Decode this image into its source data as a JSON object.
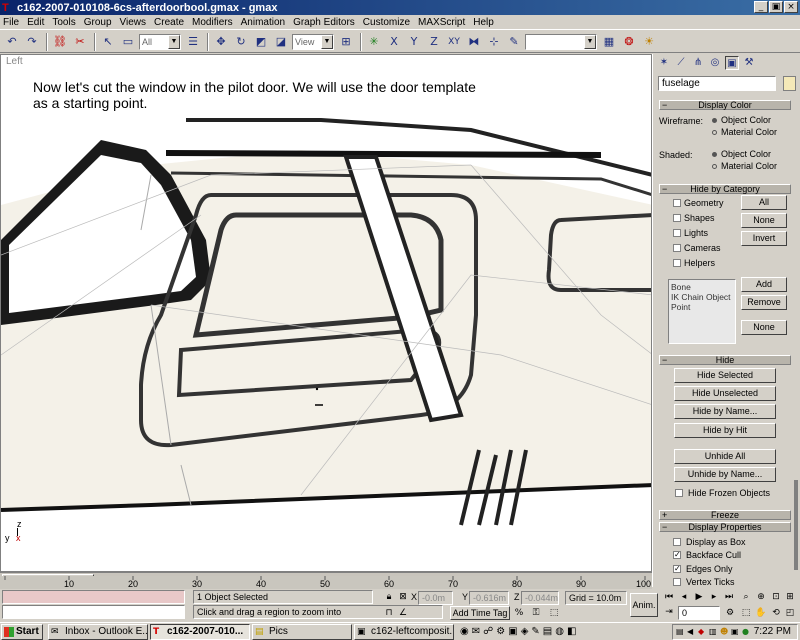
{
  "window": {
    "title": "c162-2007-010108-6cs-afterdoorbool.gmax - gmax",
    "minimize": "_",
    "restore": "▣",
    "close": "×"
  },
  "menu": [
    "File",
    "Edit",
    "Tools",
    "Group",
    "Views",
    "Create",
    "Modifiers",
    "Animation",
    "Graph Editors",
    "Customize",
    "MAXScript",
    "Help"
  ],
  "toolbar": {
    "selection_filter": "All",
    "reference_coord": "View",
    "snap_labels": [
      "X",
      "Y",
      "Z",
      "XY"
    ],
    "named_selection": ""
  },
  "viewport": {
    "label": "Left",
    "instruction": "Now let's cut the window in the pilot door.  We will use the door template as a starting point.",
    "axis_z": "z",
    "axis_y": "y",
    "axis_x": "x"
  },
  "command_panel": {
    "object_name": "fuselage",
    "display_color": {
      "title": "Display Color",
      "wireframe_label": "Wireframe:",
      "shaded_label": "Shaded:",
      "object_color": "Object Color",
      "material_color": "Material Color"
    },
    "hide_by_category": {
      "title": "Hide by Category",
      "items": [
        "Geometry",
        "Shapes",
        "Lights",
        "Cameras",
        "Helpers"
      ],
      "all_button": "All",
      "none_button": "None",
      "invert_button": "Invert",
      "list_items": [
        "Bone",
        "IK Chain Object",
        "Point"
      ],
      "add_button": "Add",
      "remove_button": "Remove",
      "none2_button": "None"
    },
    "hide": {
      "title": "Hide",
      "buttons": [
        "Hide Selected",
        "Hide Unselected",
        "Hide by Name...",
        "Hide by Hit",
        "Unhide All",
        "Unhide by Name..."
      ],
      "frozen_label": "Hide Frozen Objects"
    },
    "freeze": {
      "title": "Freeze"
    },
    "display_properties": {
      "title": "Display Properties",
      "items": [
        {
          "label": "Display as Box",
          "checked": false
        },
        {
          "label": "Backface Cull",
          "checked": true
        },
        {
          "label": "Edges Only",
          "checked": true
        },
        {
          "label": "Vertex Ticks",
          "checked": false
        }
      ]
    }
  },
  "timeline": {
    "slider_label": "0 / 100",
    "ticks": [
      "10",
      "20",
      "30",
      "40",
      "50",
      "60",
      "70",
      "80",
      "90",
      "100"
    ]
  },
  "status": {
    "selection": "1 Object Selected",
    "prompt": "Click and drag a region to zoom into",
    "x_label": "X",
    "x_value": "-0.0m",
    "y_label": "Y",
    "y_value": "-0.616m",
    "z_label": "Z",
    "z_value": "-0.044m",
    "grid": "Grid = 10.0m",
    "add_time_tag": "Add Time Tag",
    "anim": "Anim.",
    "frame": "0"
  },
  "taskbar": {
    "start": "Start",
    "tasks": [
      {
        "label": "Inbox - Outlook E...",
        "active": false,
        "icon": "✉"
      },
      {
        "label": "c162-2007-010...",
        "active": true,
        "icon": "T"
      },
      {
        "label": "Pics",
        "active": false,
        "icon": "▤"
      },
      {
        "label": "c162-leftcomposit...",
        "active": false,
        "icon": "▣"
      }
    ],
    "clock": "7:22 PM"
  }
}
